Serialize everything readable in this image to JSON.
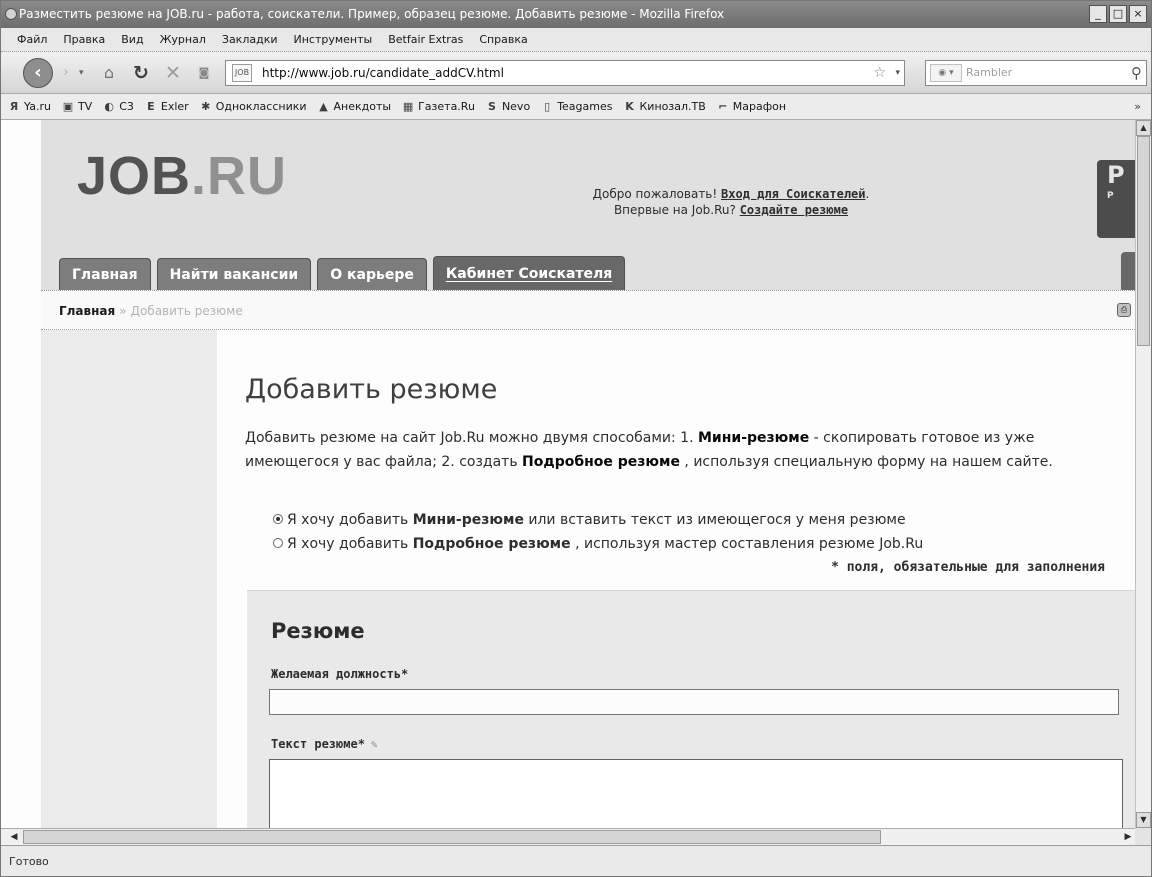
{
  "window": {
    "title": "Разместить резюме на JOB.ru - работа, соискатели. Пример, образец резюме. Добавить резюме - Mozilla Firefox",
    "buttons": {
      "minimize": "_",
      "maximize": "□",
      "close": "×"
    }
  },
  "menu": [
    "Файл",
    "Правка",
    "Вид",
    "Журнал",
    "Закладки",
    "Инструменты",
    "Betfair Extras",
    "Справка"
  ],
  "toolbar": {
    "url": "http://www.job.ru/candidate_addCV.html",
    "search_placeholder": "Rambler",
    "search_engine": "Rambler"
  },
  "bookmarks": [
    {
      "icon": "Я",
      "label": "Ya.ru"
    },
    {
      "icon": "▣",
      "label": "TV"
    },
    {
      "icon": "◐",
      "label": "C3"
    },
    {
      "icon": "E",
      "label": "Exler"
    },
    {
      "icon": "✱",
      "label": "Одноклассники"
    },
    {
      "icon": "▲",
      "label": "Анекдоты"
    },
    {
      "icon": "▦",
      "label": "Газета.Ru"
    },
    {
      "icon": "S",
      "label": "Nevo"
    },
    {
      "icon": "▯",
      "label": "Teagames"
    },
    {
      "icon": "K",
      "label": "Кинозал.ТВ"
    },
    {
      "icon": "⌐",
      "label": "Марафон"
    }
  ],
  "bookmarks_more": "»",
  "site": {
    "logo_part1": "JOB",
    "logo_part2": ".RU",
    "welcome_prefix": "Добро пожаловать! ",
    "login_link": "Вход для Соискателей",
    "welcome_mid": "Впервые на Job.Ru? ",
    "create_link": "Создайте резюме",
    "badge": "P",
    "badge_small": "P",
    "tabs": [
      "Главная",
      "Найти вакансии",
      "О карьере",
      "Кабинет Соискателя"
    ],
    "active_tab": "Кабинет Соискателя"
  },
  "breadcrumb": {
    "home": "Главная",
    "separator": "»",
    "current": "Добавить резюме"
  },
  "main": {
    "title": "Добавить резюме",
    "intro_1": "Добавить резюме на сайт Job.Ru можно двумя способами: 1. ",
    "intro_mini": "Мини-резюме",
    "intro_2": " - скопировать готовое из уже имеющегося у вас файла; 2. создать ",
    "intro_full": "Подробное резюме",
    "intro_3": " , используя специальную форму на нашем сайте.",
    "radio_1_prefix": "Я хочу добавить ",
    "radio_1_bold": "Мини-резюме",
    "radio_1_suffix": " или вставить текст из имеющегося у меня резюме",
    "radio_2_prefix": "Я хочу добавить ",
    "radio_2_bold": "Подробное резюме",
    "radio_2_suffix": " , используя мастер составления резюме Job.Ru",
    "selected_radio": 1,
    "required_note": "* поля, обязательные для заполнения"
  },
  "form": {
    "title": "Резюме",
    "position_label": "Желаемая должность*",
    "position_value": "",
    "text_label": "Текст резюме*",
    "text_value": ""
  },
  "status": "Готово"
}
